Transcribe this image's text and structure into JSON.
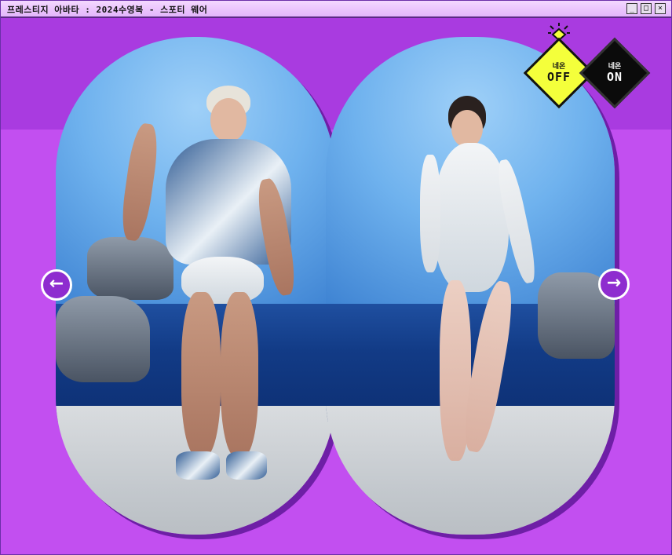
{
  "window": {
    "title": "프레스티지 아바타 : 2024수영복 - 스포티 웨어",
    "minimize_label": "_",
    "maximize_label": "□",
    "close_label": "×"
  },
  "navigation": {
    "prev_label": "←",
    "next_label": "→"
  },
  "neon_toggle": {
    "off": {
      "small": "네온",
      "big": "OFF",
      "color": "#f4ff3b"
    },
    "on": {
      "small": "네온",
      "big": "ON",
      "color": "#0b0b0b"
    },
    "indicator_icon": "light-bulb-icon"
  },
  "colors": {
    "background_top": "#a93be0",
    "background_bottom": "#c24ff0",
    "arrow": "#8e2ccf"
  }
}
